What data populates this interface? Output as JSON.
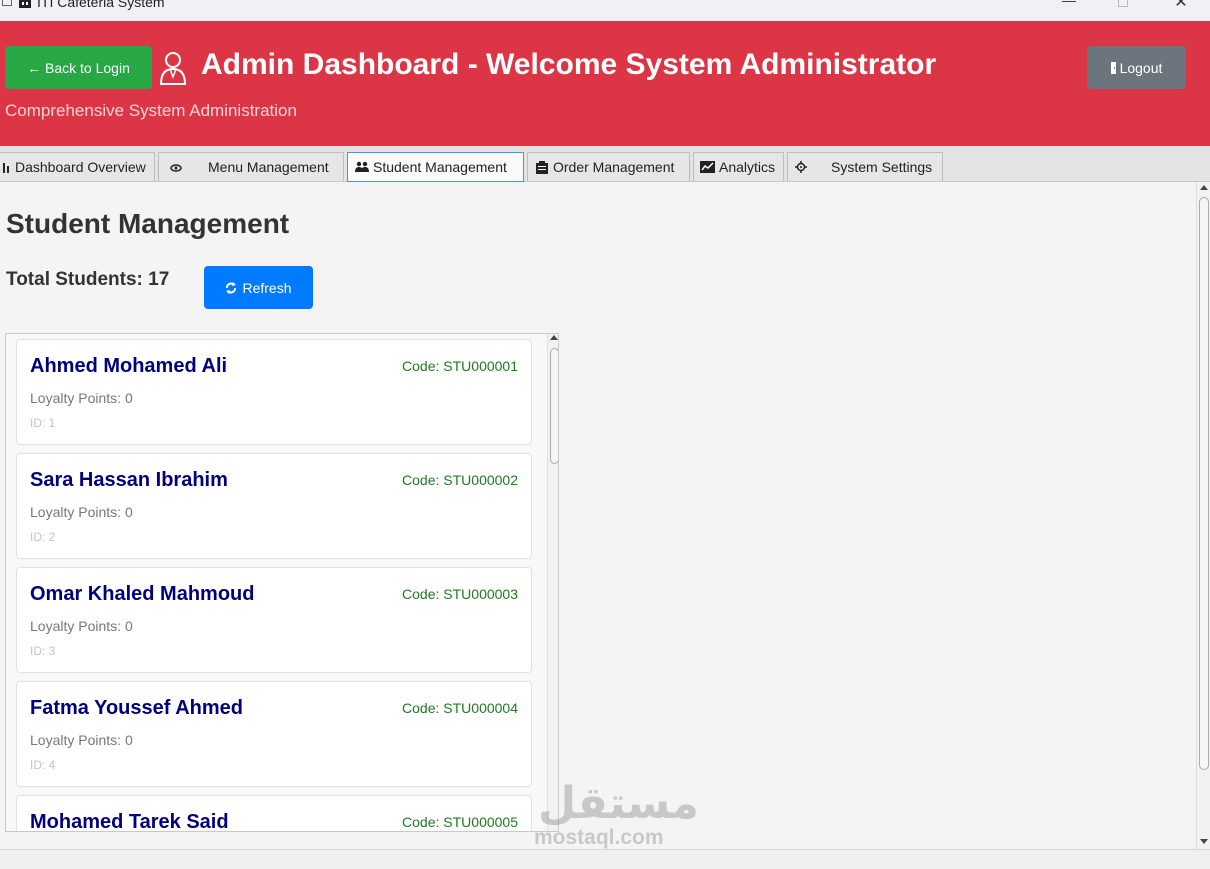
{
  "window": {
    "title": "ITI Cafeteria System",
    "minimize_glyph": "—",
    "close_glyph": "✕"
  },
  "header": {
    "back_label": "← Back to Login",
    "title": "Admin Dashboard - Welcome System Administrator",
    "subtitle": "Comprehensive System Administration",
    "logout_label": "Logout",
    "accent_color": "#dc3545"
  },
  "tabs": [
    {
      "label": "Dashboard Overview",
      "icon": "bar-chart-icon"
    },
    {
      "label": "Menu Management",
      "icon": "dish-icon"
    },
    {
      "label": "Student Management",
      "icon": "users-icon",
      "active": true
    },
    {
      "label": "Order Management",
      "icon": "clipboard-icon"
    },
    {
      "label": "Analytics",
      "icon": "line-chart-icon"
    },
    {
      "label": "System Settings",
      "icon": "gear-icon"
    }
  ],
  "main": {
    "title": "Student Management",
    "total_label": "Total Students: 17",
    "refresh_label": "Refresh"
  },
  "students": [
    {
      "name": "Ahmed Mohamed Ali",
      "code": "Code: STU000001",
      "points": "Loyalty Points: 0",
      "id": "ID: 1"
    },
    {
      "name": "Sara Hassan Ibrahim",
      "code": "Code: STU000002",
      "points": "Loyalty Points: 0",
      "id": "ID: 2"
    },
    {
      "name": "Omar Khaled Mahmoud",
      "code": "Code: STU000003",
      "points": "Loyalty Points: 0",
      "id": "ID: 3"
    },
    {
      "name": "Fatma Youssef Ahmed",
      "code": "Code: STU000004",
      "points": "Loyalty Points: 0",
      "id": "ID: 4"
    },
    {
      "name": "Mohamed Tarek Said",
      "code": "Code: STU000005",
      "points": "",
      "id": ""
    }
  ],
  "watermark": {
    "arabic": "مستقل",
    "latin": "mostaql.com"
  }
}
